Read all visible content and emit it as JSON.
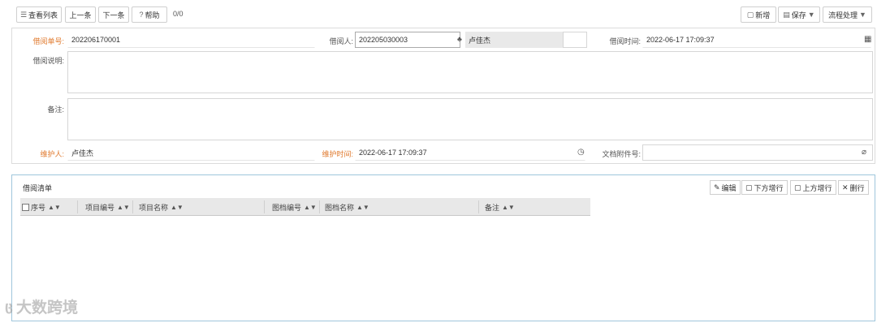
{
  "toolbar": {
    "view_list": "查看列表",
    "prev": "上一条",
    "next": "下一条",
    "help": "帮助",
    "counter": "0/0",
    "new": "新增",
    "save": "保存",
    "workflow": "流程处理"
  },
  "form": {
    "borrow_no_label": "借阅单号:",
    "borrow_no_value": "202206170001",
    "borrower_label": "借阅人:",
    "borrower_id": "202205030003",
    "borrower_name": "卢佳杰",
    "borrow_time_label": "借阅时间:",
    "borrow_time_value": "2022-06-17 17:09:37",
    "description_label": "借阅说明:",
    "remark_label": "备注:",
    "maintainer_label": "维护人:",
    "maintainer_value": "卢佳杰",
    "maintain_time_label": "维护时间:",
    "maintain_time_value": "2022-06-17 17:09:37",
    "attachment_label": "文档附件号:"
  },
  "list": {
    "title": "借阅清单",
    "edit": "编辑",
    "add_below": "下方增行",
    "add_above": "上方增行",
    "delete_row": "删行",
    "columns": [
      "序号",
      "项目编号",
      "项目名称",
      "图档编号",
      "图档名称",
      "备注"
    ]
  },
  "watermark": "大数跨境",
  "colors": {
    "required_label": "#e07a2e",
    "list_border": "#9fc6dc",
    "header_bg": "#e8e8e8"
  }
}
